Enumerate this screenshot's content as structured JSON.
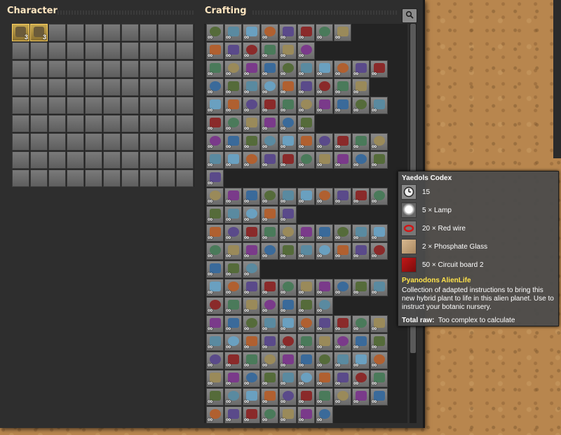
{
  "character": {
    "title": "Character",
    "slots": [
      {
        "count": "3"
      },
      {
        "count": "3"
      }
    ]
  },
  "crafting": {
    "title": "Crafting",
    "infinity": "∞"
  },
  "icons": {
    "search": "search-icon"
  },
  "tooltip": {
    "title": "Yaedols Codex",
    "time": "15",
    "ingredients": [
      {
        "label": "5 × Lamp"
      },
      {
        "label": "20 × Red wire"
      },
      {
        "label": "2 × Phosphate Glass"
      },
      {
        "label": "50 × Circuit board 2"
      }
    ],
    "subtitle": "Pyanodons AlienLife",
    "description": "Collection of adapted instructions to bring this new hybrid plant to life in this alien planet. Use to instruct your botanic nursery.",
    "total_label": "Total raw:",
    "total_value": "Too complex to calculate"
  },
  "colors": {
    "accent_title": "#ffe6c0",
    "subtitle": "#ffe34a",
    "selected_slot": "#ffd060"
  }
}
